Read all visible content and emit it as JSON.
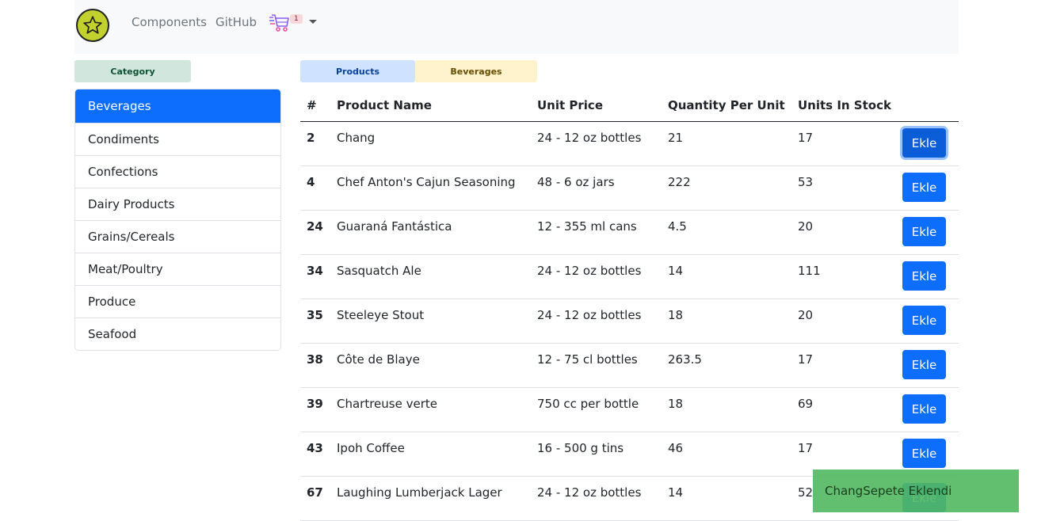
{
  "navbar": {
    "logo_icon": "star-icon",
    "links": [
      "Components",
      "GitHub"
    ],
    "cart_icon": "shopping-cart-icon",
    "cart_count": "1"
  },
  "labels": {
    "category": "Category",
    "products": "Products",
    "current_category": "Beverages"
  },
  "categories": [
    "Beverages",
    "Condiments",
    "Confections",
    "Dairy Products",
    "Grains/Cereals",
    "Meat/Poultry",
    "Produce",
    "Seafood"
  ],
  "table": {
    "headers": [
      "#",
      "Product Name",
      "Unit Price",
      "Quantity Per Unit",
      "Units In Stock"
    ],
    "rows": [
      {
        "id": "2",
        "name": "Chang",
        "price": "24 - 12 oz bottles",
        "qty": "21",
        "stock": "17"
      },
      {
        "id": "4",
        "name": "Chef Anton's Cajun Seasoning",
        "price": "48 - 6 oz jars",
        "qty": "222",
        "stock": "53"
      },
      {
        "id": "24",
        "name": "Guaraná Fantástica",
        "price": "12 - 355 ml cans",
        "qty": "4.5",
        "stock": "20"
      },
      {
        "id": "34",
        "name": "Sasquatch Ale",
        "price": "24 - 12 oz bottles",
        "qty": "14",
        "stock": "111"
      },
      {
        "id": "35",
        "name": "Steeleye Stout",
        "price": "24 - 12 oz bottles",
        "qty": "18",
        "stock": "20"
      },
      {
        "id": "38",
        "name": "Côte de Blaye",
        "price": "12 - 75 cl bottles",
        "qty": "263.5",
        "stock": "17"
      },
      {
        "id": "39",
        "name": "Chartreuse verte",
        "price": "750 cc per bottle",
        "qty": "18",
        "stock": "69"
      },
      {
        "id": "43",
        "name": "Ipoh Coffee",
        "price": "16 - 500 g tins",
        "qty": "46",
        "stock": "17"
      },
      {
        "id": "67",
        "name": "Laughing Lumberjack Lager",
        "price": "24 - 12 oz bottles",
        "qty": "14",
        "stock": "52"
      }
    ],
    "add_label": "Ekle"
  },
  "toast": {
    "message": "ChangSepete Eklendi"
  },
  "colors": {
    "primary": "#0d6efd",
    "navbar_bg": "#f8f9fa",
    "toast_bg": "#51b860",
    "logo": "#c3d12e"
  }
}
